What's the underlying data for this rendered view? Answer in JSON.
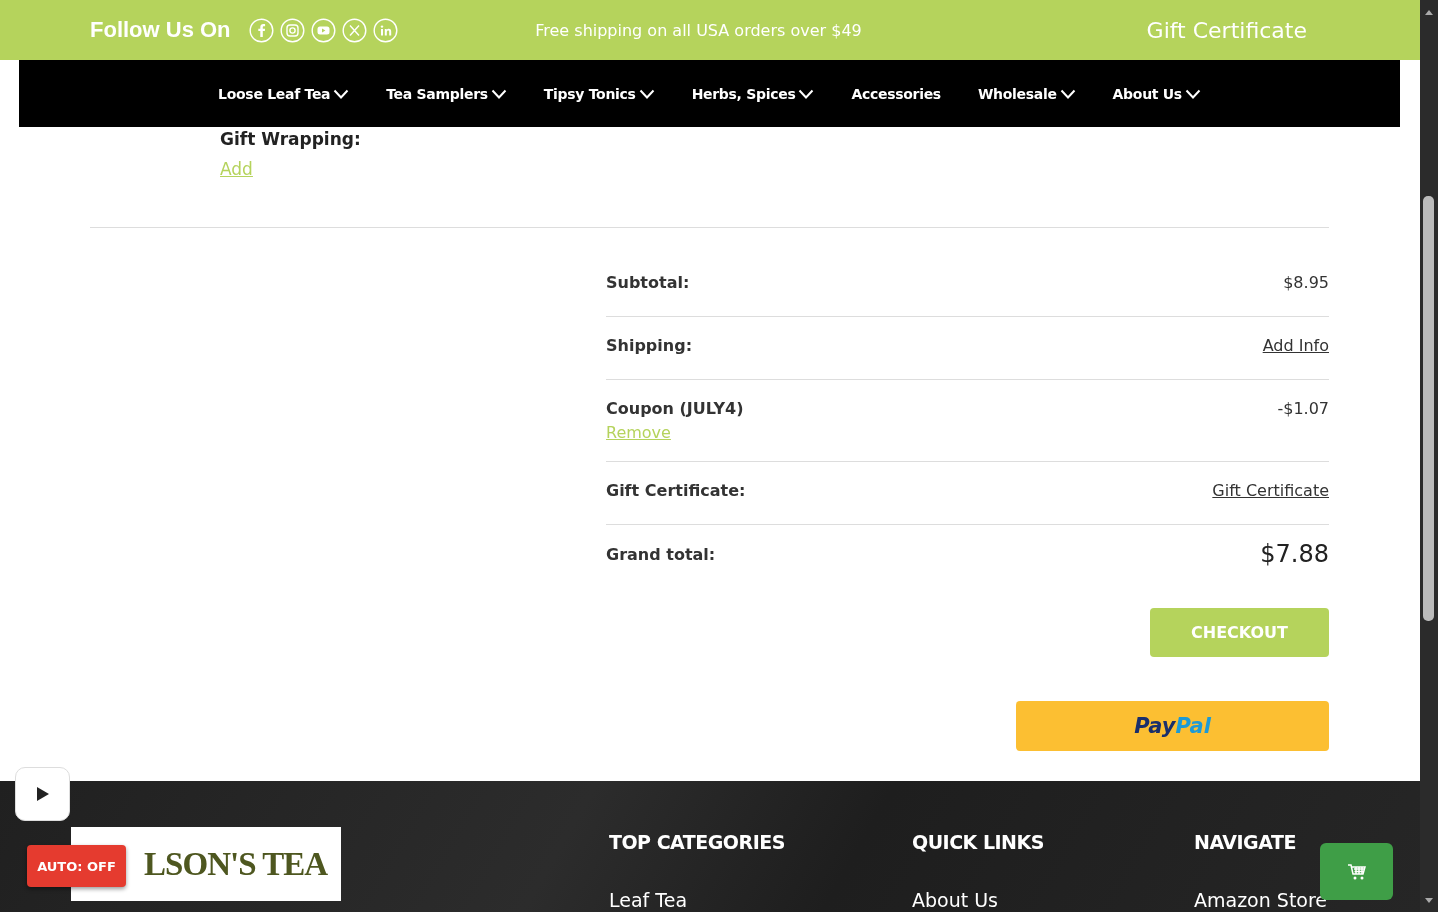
{
  "top_bar": {
    "follow_label": "Follow Us On",
    "social": [
      {
        "kind": "facebook"
      },
      {
        "kind": "instagram"
      },
      {
        "kind": "youtube"
      },
      {
        "kind": "x"
      },
      {
        "kind": "linkedin"
      }
    ],
    "promo": "Free shipping on all USA orders over $49",
    "gift_link": "Gift Certificate"
  },
  "nav": [
    {
      "label": "Loose Leaf Tea",
      "dropdown": true
    },
    {
      "label": "Tea Samplers",
      "dropdown": true
    },
    {
      "label": "Tipsy Tonics",
      "dropdown": true
    },
    {
      "label": "Herbs, Spices",
      "dropdown": true
    },
    {
      "label": "Accessories",
      "dropdown": false
    },
    {
      "label": "Wholesale",
      "dropdown": true
    },
    {
      "label": "About Us",
      "dropdown": true
    }
  ],
  "gift_wrapping": {
    "label": "Gift Wrapping:",
    "action": "Add"
  },
  "summary": [
    {
      "label": "Subtotal:",
      "kind": "amount",
      "value": "$8.95"
    },
    {
      "label": "Shipping:",
      "kind": "link",
      "value": "Add Info"
    },
    {
      "label": "Coupon (JULY4)",
      "kind": "coupon",
      "value": "-$1.07",
      "action": "Remove"
    },
    {
      "label": "Gift Certificate:",
      "kind": "link",
      "value": "Gift Certificate"
    },
    {
      "label": "Grand total:",
      "kind": "total",
      "value": "$7.88"
    }
  ],
  "checkout_button": "CHECKOUT",
  "paypal_button": [
    "Pay",
    "Pal"
  ],
  "footer": {
    "logo_text": "LSON'S TEA",
    "columns": [
      {
        "heading": "TOP CATEGORIES",
        "links": [
          "Leaf Tea"
        ]
      },
      {
        "heading": "QUICK LINKS",
        "links": [
          "About Us"
        ]
      },
      {
        "heading": "NAVIGATE",
        "links": [
          "Amazon Store"
        ]
      }
    ]
  },
  "auto_badge": "AUTO: OFF"
}
